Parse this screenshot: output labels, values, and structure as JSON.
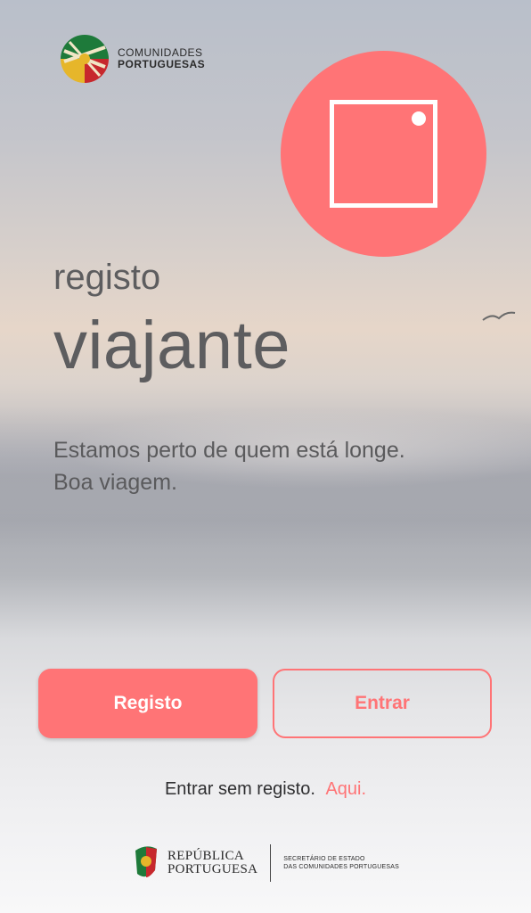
{
  "app": {
    "logo": {
      "line1": "COMUNIDADES",
      "line2": "PORTUGUESAS"
    }
  },
  "camera_button": {
    "icon": "camera-icon"
  },
  "headings": {
    "small": "registo",
    "large": "viajante"
  },
  "tagline": {
    "line1": "Estamos perto de quem está longe.",
    "line2": "Boa viagem."
  },
  "buttons": {
    "register": "Registo",
    "enter": "Entrar"
  },
  "guest": {
    "text": "Entrar sem registo.",
    "link": "Aqui."
  },
  "footer": {
    "gov_line1": "REPÚBLICA",
    "gov_line2": "PORTUGUESA",
    "sub_line1": "SECRETÁRIO DE ESTADO",
    "sub_line2": "DAS COMUNIDADES PORTUGUESAS"
  },
  "colors": {
    "accent": "#ff7476",
    "text": "#5d5d5f"
  }
}
